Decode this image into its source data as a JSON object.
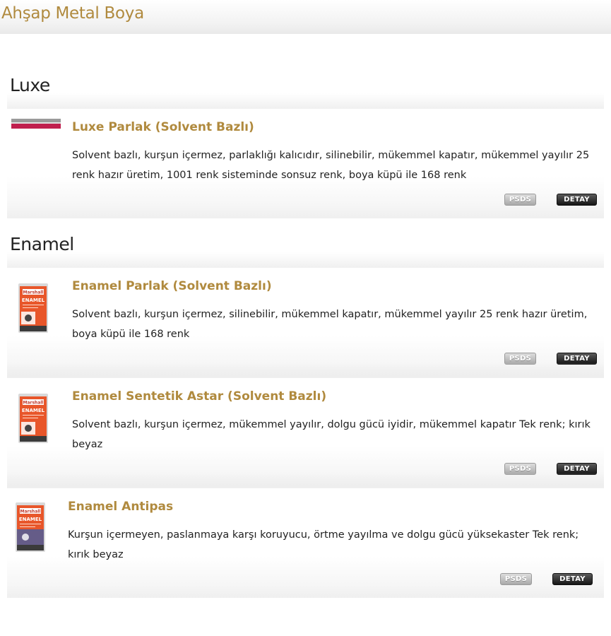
{
  "page": {
    "title": "Ahşap Metal Boya"
  },
  "sections": [
    {
      "title": "Luxe",
      "products": [
        {
          "name": "Luxe Parlak (Solvent Bazlı)",
          "description": "Solvent bazlı, kurşun içermez, parlaklığı kalıcıdır, silinebilir, mükemmel kapatır, mükemmel yayılır 25 renk hazır üretim, 1001 renk sisteminde sonsuz renk, boya küpü ile 168 renk",
          "thumbnail_icon": "luxe-paint-can-icon",
          "psds_label": "PSDS",
          "detay_label": "DETAY"
        }
      ]
    },
    {
      "title": "Enamel",
      "products": [
        {
          "name": "Enamel Parlak (Solvent Bazlı)",
          "description": "Solvent bazlı, kurşun içermez, silinebilir, mükemmel kapatır, mükemmel yayılır 25 renk hazır üretim, boya küpü ile 168 renk",
          "thumbnail_icon": "enamel-paint-can-icon",
          "psds_label": "PSDS",
          "detay_label": "DETAY"
        },
        {
          "name": "Enamel Sentetik Astar (Solvent Bazlı)",
          "description": "Solvent bazlı, kurşun içermez, mükemmel yayılır, dolgu gücü iyidir, mükemmel kapatır Tek renk; kırık beyaz",
          "thumbnail_icon": "enamel-paint-can-icon",
          "psds_label": "PSDS",
          "detay_label": "DETAY"
        },
        {
          "name": "Enamel Antipas",
          "description": "Kurşun içermeyen, paslanmaya karşı koruyucu, örtme yayılma ve dolgu gücü yüksekaster Tek renk; kırık beyaz",
          "thumbnail_icon": "enamel-paint-can-icon",
          "psds_label": "PSDS",
          "detay_label": "DETAY"
        }
      ]
    }
  ],
  "can_labels": {
    "brand": "Marshall",
    "product": "ENAMEL"
  },
  "colors": {
    "accent_gold": "#b08a3e",
    "heading_dark": "#222222",
    "can_orange": "#e8562a",
    "luxe_red": "#c01f4e"
  }
}
